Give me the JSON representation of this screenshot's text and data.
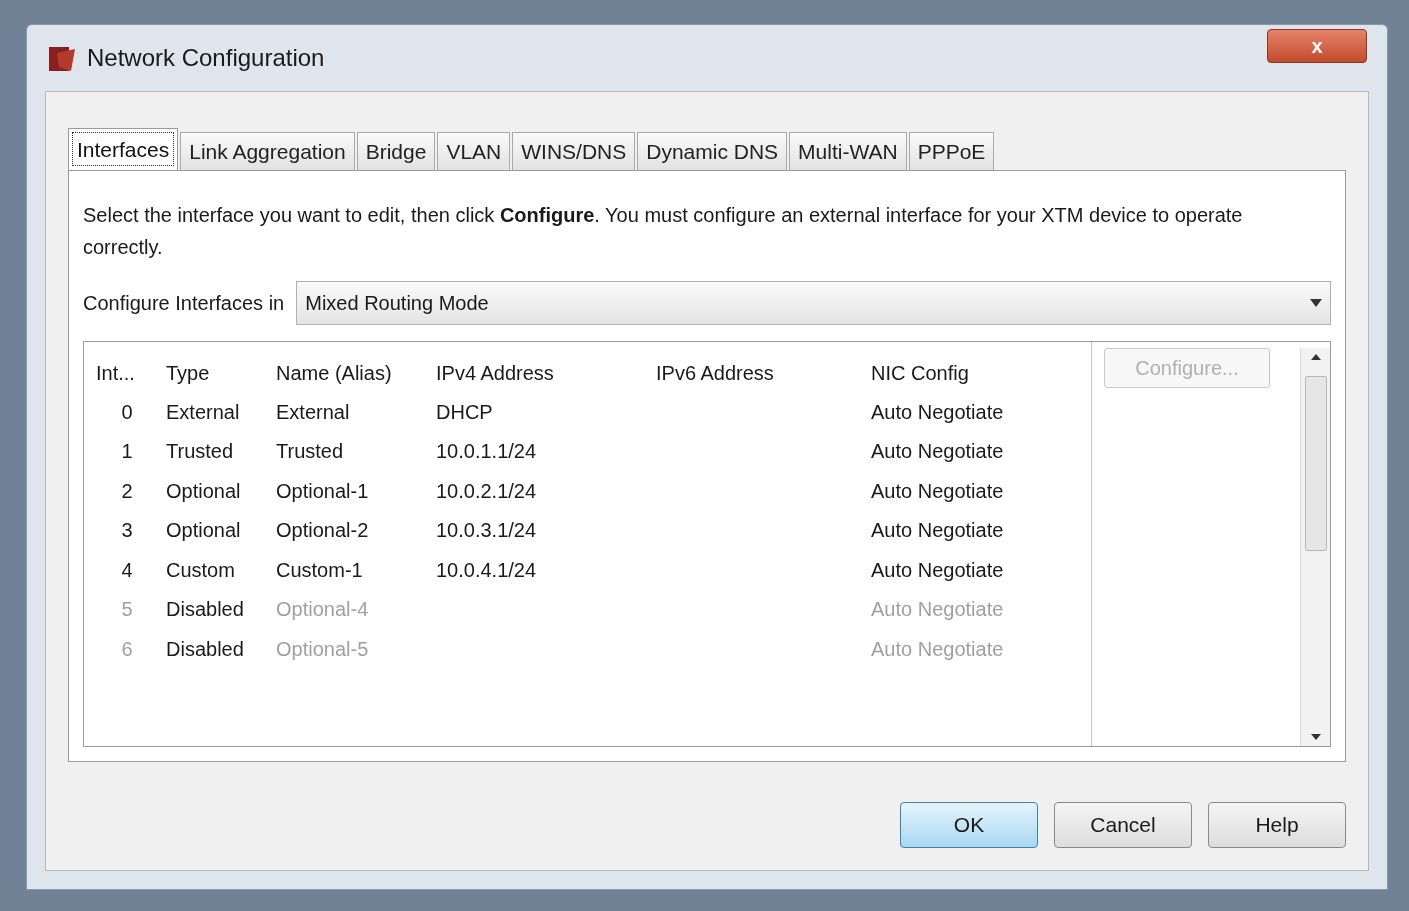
{
  "window": {
    "title": "Network Configuration",
    "close": "x"
  },
  "tabs": [
    {
      "label": "Interfaces",
      "selected": true
    },
    {
      "label": "Link Aggregation",
      "selected": false
    },
    {
      "label": "Bridge",
      "selected": false
    },
    {
      "label": "VLAN",
      "selected": false
    },
    {
      "label": "WINS/DNS",
      "selected": false
    },
    {
      "label": "Dynamic DNS",
      "selected": false
    },
    {
      "label": "Multi-WAN",
      "selected": false
    },
    {
      "label": "PPPoE",
      "selected": false
    }
  ],
  "description": "Select the interface you want to edit, then click **Configure**. You must configure an external interface for your XTM device to operate correctly.",
  "mode": {
    "label": "Configure Interfaces in",
    "value": "Mixed Routing Mode"
  },
  "table": {
    "columns": [
      "Int...",
      "Type",
      "Name (Alias)",
      "IPv4 Address",
      "IPv6 Address",
      "NIC Config"
    ],
    "rows": [
      {
        "cells": [
          "0",
          "External",
          "External",
          "DHCP",
          "",
          "Auto Negotiate"
        ],
        "disabled": false
      },
      {
        "cells": [
          "1",
          "Trusted",
          "Trusted",
          "10.0.1.1/24",
          "",
          "Auto Negotiate"
        ],
        "disabled": false
      },
      {
        "cells": [
          "2",
          "Optional",
          "Optional-1",
          "10.0.2.1/24",
          "",
          "Auto Negotiate"
        ],
        "disabled": false
      },
      {
        "cells": [
          "3",
          "Optional",
          "Optional-2",
          "10.0.3.1/24",
          "",
          "Auto Negotiate"
        ],
        "disabled": false
      },
      {
        "cells": [
          "4",
          "Custom",
          "Custom-1",
          "10.0.4.1/24",
          "",
          "Auto Negotiate"
        ],
        "disabled": false
      },
      {
        "cells": [
          "5",
          "Disabled",
          "Optional-4",
          "",
          "",
          "Auto Negotiate"
        ],
        "disabled": true
      },
      {
        "cells": [
          "6",
          "Disabled",
          "Optional-5",
          "",
          "",
          "Auto Negotiate"
        ],
        "disabled": true
      }
    ]
  },
  "configure_button": {
    "label": "Configure...",
    "disabled": true
  },
  "buttons": [
    {
      "label": "OK",
      "default": true
    },
    {
      "label": "Cancel",
      "default": false
    },
    {
      "label": "Help",
      "default": false
    }
  ]
}
